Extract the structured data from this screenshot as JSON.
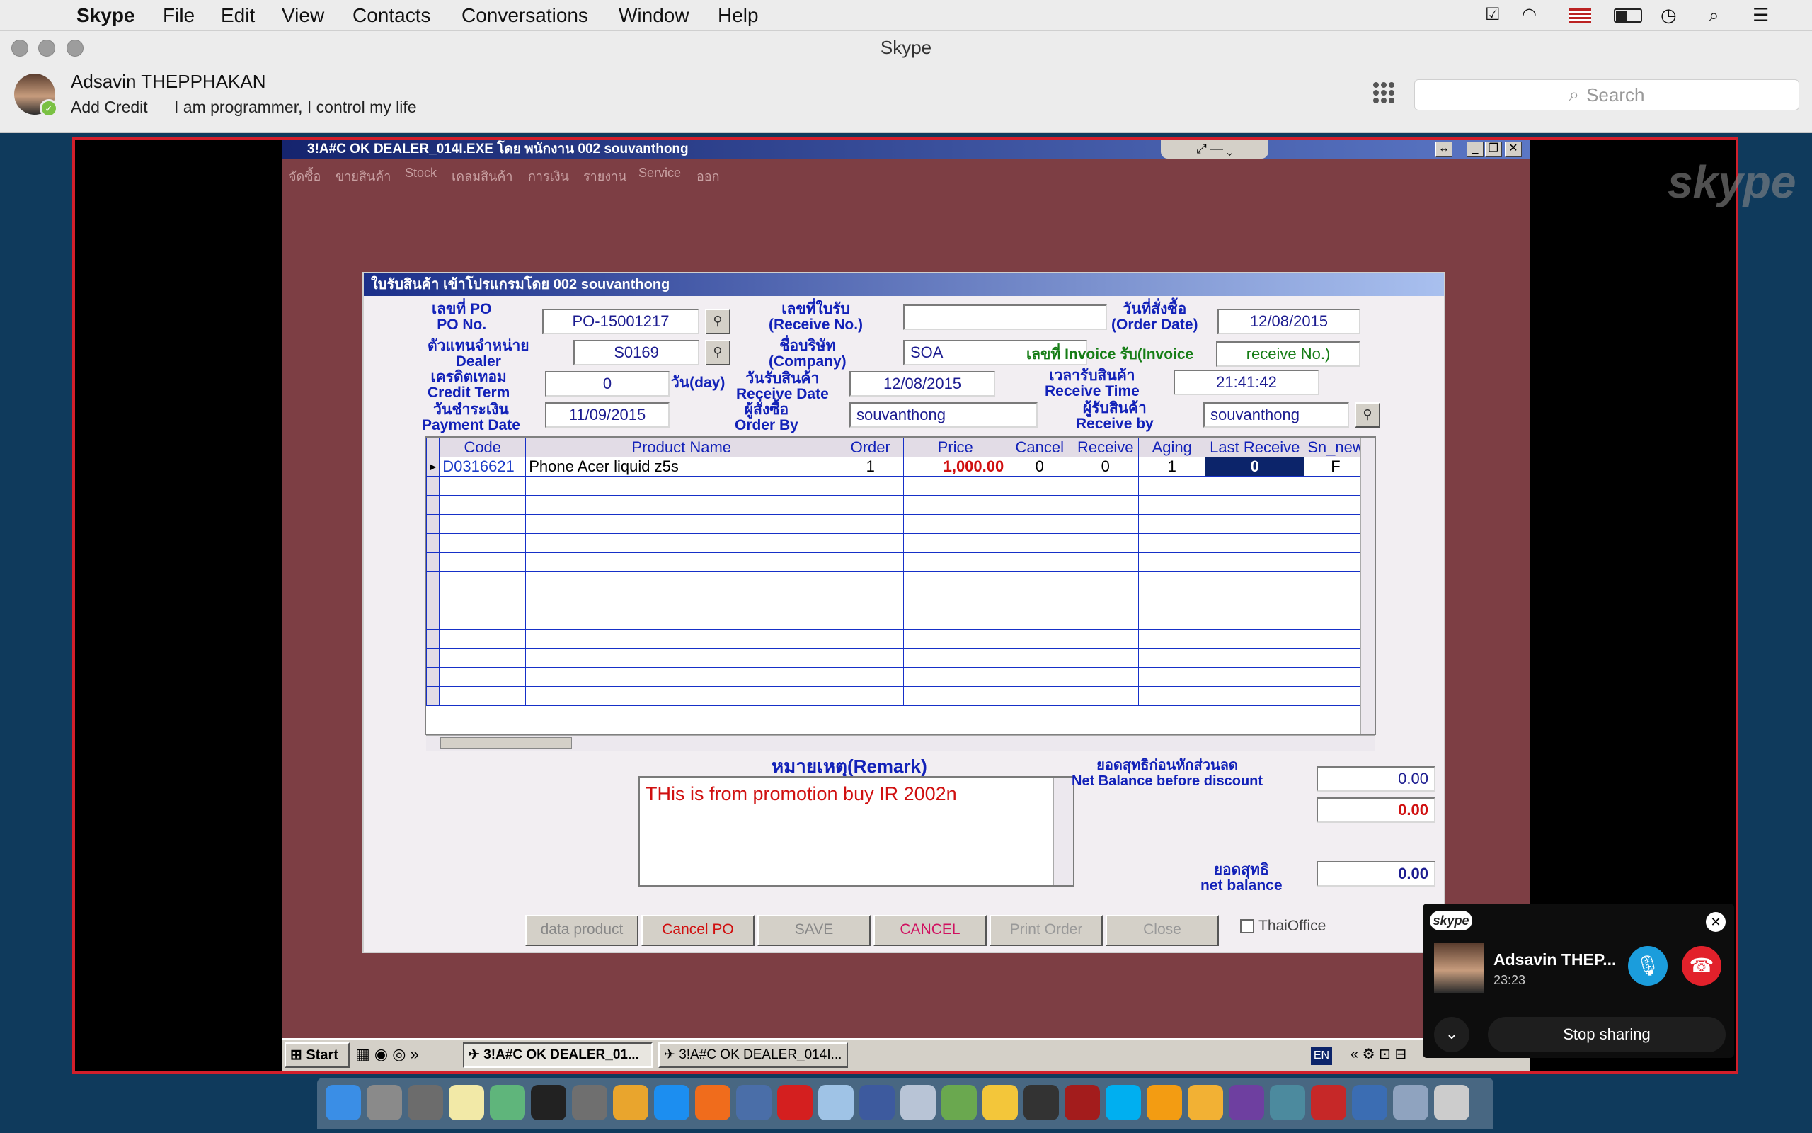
{
  "menubar": {
    "app": "Skype",
    "items": [
      "File",
      "Edit",
      "View",
      "Contacts",
      "Conversations",
      "Window",
      "Help"
    ]
  },
  "skype": {
    "window_title": "Skype",
    "user_name": "Adsavin THEPPHAKAN",
    "add_credit": "Add Credit",
    "mood": "I am programmer, I control my life",
    "search_placeholder": "Search"
  },
  "app": {
    "title": "3!A#C OK DEALER_014I.EXE โดย พนักงาน 002 souvanthong",
    "menu": [
      "จัดซื้อ",
      "ขายสินค้า",
      "Stock",
      "เคลมสินค้า",
      "การเงิน",
      "รายงาน",
      "Service",
      "ออก"
    ]
  },
  "dialog": {
    "title": "ใบรับสินค้า เข้าโปรแกรมโดย 002 souvanthong",
    "po_label": "เลขที่ PO\nPO No.",
    "po_no": "PO-15001217",
    "receive_no_label": "เลขที่ใบรับ\n(Receive No.)",
    "receive_no": "",
    "order_date_label": "วันที่สั่งซื้อ\n(Order Date)",
    "order_date": "12/08/2015",
    "dealer_label": "ตัวแทนจำหน่าย\nDealer",
    "dealer": "S0169",
    "company_label": "ชื่อบริษัท\n(Company)",
    "company": "SOA",
    "invoice_label": "เลขที่ Invoice รับ(Invoice",
    "invoice_value": "receive No.)",
    "credit_label": "เครดิตเทอม\nCredit Term",
    "credit_term": "0",
    "credit_unit": "วัน(day)",
    "receive_date_label": "วันรับสินค้า\nReceive Date",
    "receive_date": "12/08/2015",
    "receive_time_label": "เวลารับสินค้า\nReceive Time",
    "receive_time": "21:41:42",
    "payment_label": "วันชำระเงิน\nPayment Date",
    "payment_date": "11/09/2015",
    "order_by_label": "ผู้สั่งซื้อ\nOrder By",
    "order_by": "souvanthong",
    "receive_by_label": "ผู้รับสินค้า\nReceive by",
    "receive_by": "souvanthong",
    "columns": [
      "Code",
      "Product Name",
      "Order",
      "Price",
      "Cancel",
      "Receive",
      "Aging",
      "Last Receive",
      "Sn_new"
    ],
    "rows": [
      [
        "D0316621",
        "Phone Acer liquid z5s",
        "1",
        "1,000.00",
        "0",
        "0",
        "1",
        "0",
        "F"
      ]
    ],
    "remark_label": "หมายเหตุ(Remark)",
    "remark": "THis is from promotion buy IR 2002n",
    "net_before_label": "ยอดสุทธิก่อนหักส่วนลด\nNet Balance before discount",
    "net_before": "0.00",
    "discount": "0.00",
    "net_label": "ยอดสุทธิ\nnet balance",
    "net": "0.00",
    "buttons": [
      "data product",
      "Cancel PO",
      "SAVE",
      "CANCEL",
      "Print Order",
      "Close"
    ],
    "thaioffice": "ThaiOffice"
  },
  "taskbar": {
    "start": "Start",
    "task1": "3!A#C OK DEALER_01...",
    "task2": "3!A#C OK DEALER_014I...",
    "lang": "EN"
  },
  "call": {
    "name": "Adsavin THEP...",
    "duration": "23:23",
    "stop": "Stop sharing",
    "brand": "skype"
  },
  "watermark": "skype"
}
